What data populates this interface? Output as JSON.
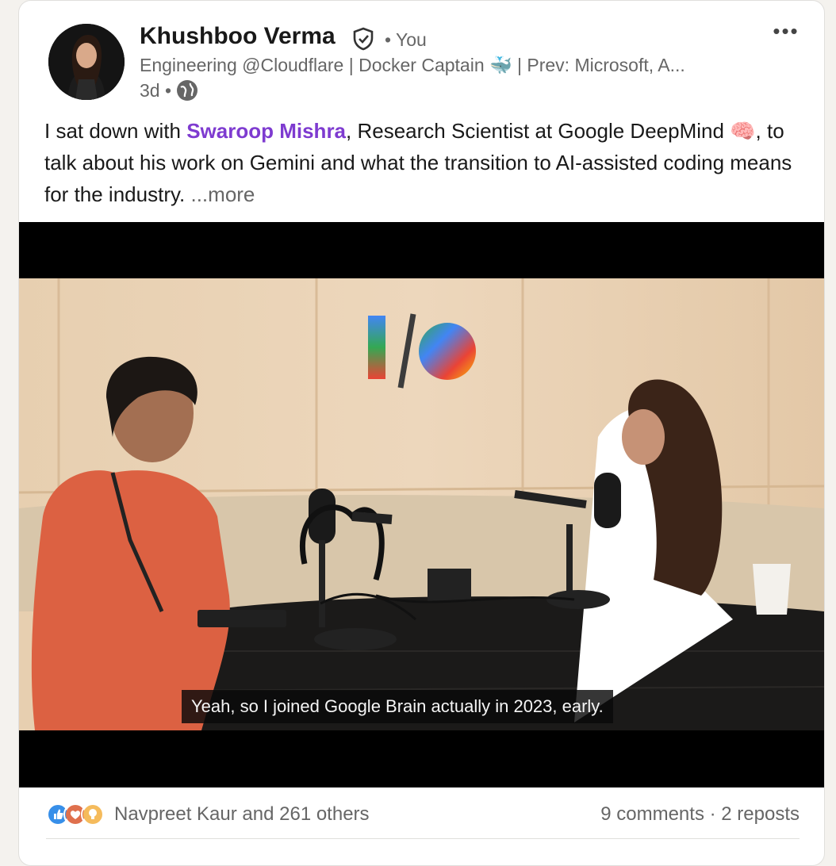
{
  "author": {
    "name": "Khushboo Verma",
    "relation": "• You",
    "headline": "Engineering @Cloudflare | Docker Captain 🐳 | Prev: Microsoft, A...",
    "time": "3d •"
  },
  "post": {
    "text_before": "I sat down with ",
    "mention": "Swaroop Mishra",
    "text_after": ", Research Scientist at Google DeepMind 🧠, to talk about his work on Gemini and what the transition to AI-assisted coding means for the industry.",
    "more_label": " ...more"
  },
  "video": {
    "subtitle": "Yeah, so I joined Google Brain actually in 2023, early."
  },
  "social": {
    "reactions_text": "Navpreet Kaur and 261 others",
    "counts_text": "9 comments · 2 reposts"
  },
  "colors": {
    "mention": "#7e3bd0",
    "like": "#378fe9",
    "love": "#df704d",
    "insightful": "#f5bb5c"
  },
  "icons": {
    "verified": "shield-check-icon",
    "visibility": "globe-icon",
    "overflow": "ellipsis-icon",
    "reactions": [
      "like-icon",
      "love-icon",
      "insightful-icon"
    ]
  }
}
